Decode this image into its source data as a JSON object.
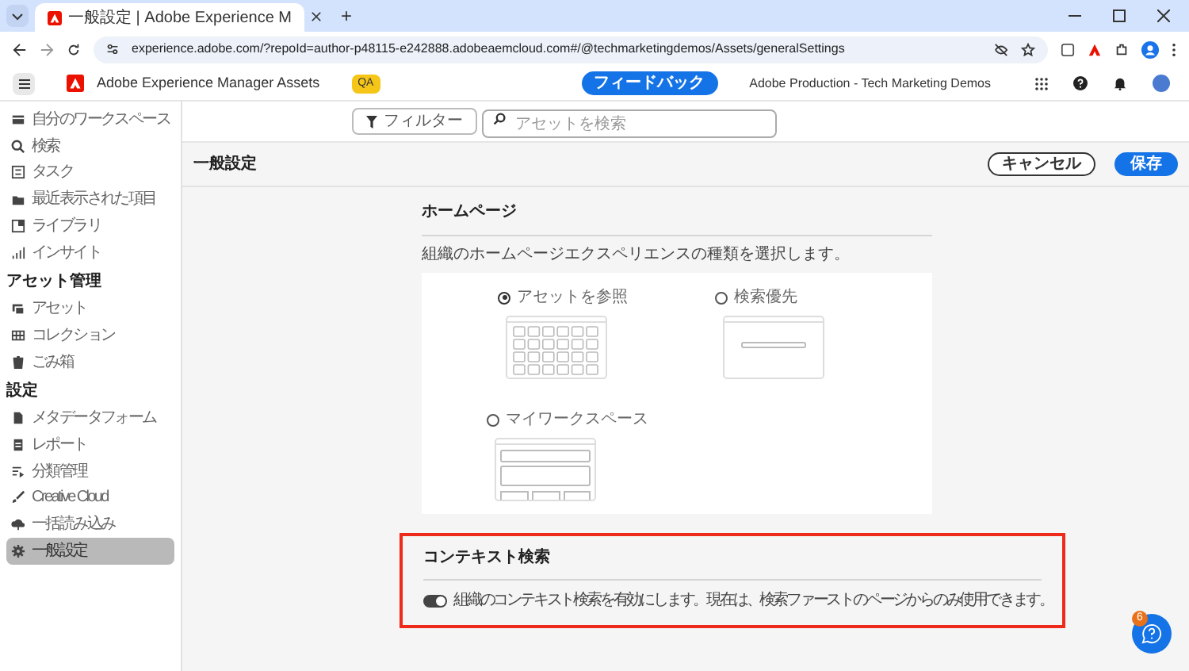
{
  "browser": {
    "tab_title": "一般設定 | Adobe Experience M",
    "new_tab": "+",
    "url": "experience.adobe.com/?repoId=author-p48115-e242888.adobeaemcloud.com#/@techmarketingdemos/Assets/generalSettings"
  },
  "header": {
    "app_name": "Adobe Experience Manager Assets",
    "env_badge": "QA",
    "feedback_button": "フィードバック",
    "org_name": "Adobe Production - Tech Marketing Demos"
  },
  "sidebar": [
    {
      "kind": "item",
      "label": "自分のワークスペース",
      "selected": false
    },
    {
      "kind": "item",
      "label": "検索",
      "selected": false
    },
    {
      "kind": "item",
      "label": "タスク",
      "selected": false
    },
    {
      "kind": "item",
      "label": "最近表示された項目",
      "selected": false
    },
    {
      "kind": "item",
      "label": "ライブラリ",
      "selected": false
    },
    {
      "kind": "item",
      "label": "インサイト",
      "selected": false
    },
    {
      "kind": "heading",
      "label": "アセット管理"
    },
    {
      "kind": "item",
      "label": "アセット",
      "selected": false
    },
    {
      "kind": "item",
      "label": "コレクション",
      "selected": false
    },
    {
      "kind": "item",
      "label": "ごみ箱",
      "selected": false
    },
    {
      "kind": "heading",
      "label": "設定"
    },
    {
      "kind": "item",
      "label": "メタデータフォーム",
      "selected": false
    },
    {
      "kind": "item",
      "label": "レポート",
      "selected": false
    },
    {
      "kind": "item",
      "label": "分類管理",
      "selected": false
    },
    {
      "kind": "item",
      "label": "Creative Cloud",
      "selected": false
    },
    {
      "kind": "item",
      "label": "一括読み込み",
      "selected": false
    },
    {
      "kind": "item",
      "label": "一般設定",
      "selected": true
    }
  ],
  "toolbar": {
    "filter_button": "フィルター",
    "search_placeholder": "アセットを検索"
  },
  "page": {
    "title": "一般設定",
    "cancel_button": "キャンセル",
    "save_button": "保存"
  },
  "homepage": {
    "heading": "ホームページ",
    "description": "組織のホームページエクスペリエンスの種類を選択します。",
    "options": [
      {
        "kind": "grid",
        "label": "アセットを参照",
        "selected": true
      },
      {
        "kind": "search",
        "label": "検索優先",
        "selected": false
      },
      {
        "kind": "workspace",
        "label": "マイワークスペース",
        "selected": false
      }
    ]
  },
  "context_search": {
    "heading": "コンテキスト検索",
    "toggle": {
      "on": true,
      "label": "組織のコンテキスト検索を有効にします。現在は、検索ファーストのページからのみ使用できます。"
    }
  },
  "help": {
    "badge": "6"
  }
}
